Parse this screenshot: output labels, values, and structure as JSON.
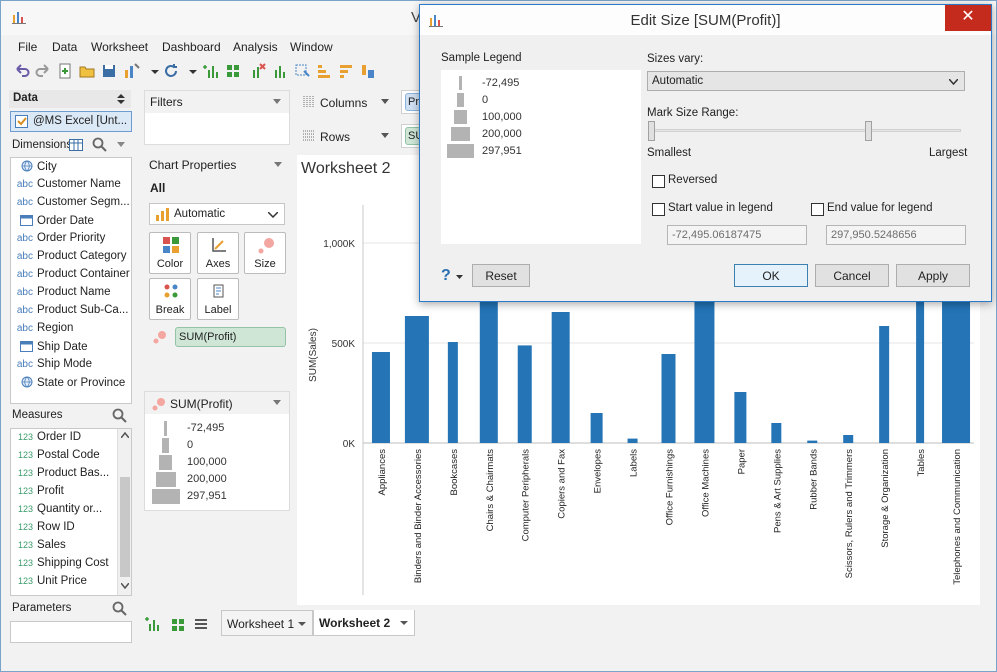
{
  "window": {
    "title": "V"
  },
  "menu": [
    "File",
    "Data",
    "Worksheet",
    "Dashboard",
    "Analysis",
    "Window"
  ],
  "data_panel": {
    "header": "Data",
    "source": "@MS Excel [Unt...",
    "dimensions_label": "Dimensions",
    "dimensions": [
      {
        "icon": "globe",
        "label": "City"
      },
      {
        "icon": "abc",
        "label": "Customer Name"
      },
      {
        "icon": "abc",
        "label": "Customer Segm..."
      },
      {
        "icon": "calendar",
        "label": "Order Date"
      },
      {
        "icon": "abc",
        "label": "Order Priority"
      },
      {
        "icon": "abc",
        "label": "Product Category"
      },
      {
        "icon": "abc",
        "label": "Product Container"
      },
      {
        "icon": "abc",
        "label": "Product Name"
      },
      {
        "icon": "abc",
        "label": "Product Sub-Ca..."
      },
      {
        "icon": "abc",
        "label": "Region"
      },
      {
        "icon": "calendar",
        "label": "Ship Date"
      },
      {
        "icon": "abc",
        "label": "Ship Mode"
      },
      {
        "icon": "globe",
        "label": "State or Province"
      }
    ],
    "measures_label": "Measures",
    "measures": [
      {
        "icon": "123",
        "label": "Order ID"
      },
      {
        "icon": "123",
        "label": "Postal Code"
      },
      {
        "icon": "123",
        "label": "Product Bas..."
      },
      {
        "icon": "123",
        "label": "Profit"
      },
      {
        "icon": "123",
        "label": "Quantity or..."
      },
      {
        "icon": "123",
        "label": "Row ID"
      },
      {
        "icon": "123",
        "label": "Sales"
      },
      {
        "icon": "123",
        "label": "Shipping Cost"
      },
      {
        "icon": "123",
        "label": "Unit Price"
      }
    ],
    "parameters_label": "Parameters",
    "abc": "abc",
    "num": "123"
  },
  "filters": {
    "label": "Filters"
  },
  "chart_properties": {
    "label": "Chart Properties",
    "all": "All",
    "mark_type": "Automatic",
    "buttons": {
      "color": "Color",
      "axes": "Axes",
      "size": "Size",
      "break": "Break",
      "label": "Label"
    },
    "size_pill": "SUM(Profit)"
  },
  "size_legend_card": {
    "title": "SUM(Profit)",
    "items": [
      "-72,495",
      "0",
      "100,000",
      "200,000",
      "297,951"
    ]
  },
  "shelves": {
    "columns": "Columns",
    "rows": "Rows",
    "columns_pill": "Pr",
    "rows_pill": "SU"
  },
  "worksheet": {
    "title": "Worksheet 2"
  },
  "chart_data": {
    "type": "bar",
    "ylabel": "SUM(Sales)",
    "y_ticks": [
      "1,000K",
      "500K",
      "0K"
    ],
    "ylim": [
      0,
      1200000
    ],
    "categories": [
      "Appliances",
      "Binders and Binder Accessories",
      "Bookcases",
      "Chairs & Chairmats",
      "Computer Peripherals",
      "Copiers and Fax",
      "Envelopes",
      "Labels",
      "Office Furnishings",
      "Office Machines",
      "Paper",
      "Pens & Art Supplies",
      "Rubber Bands",
      "Scissors, Rulers and Trimmers",
      "Storage & Organization",
      "Tables",
      "Telephones and Communication"
    ],
    "values": [
      455000,
      635000,
      505000,
      1130000,
      488000,
      655000,
      150000,
      22000,
      445000,
      1180000,
      255000,
      100000,
      12000,
      40000,
      585000,
      1100000,
      1200000
    ],
    "bar_color": "#2474b6"
  },
  "tabs": [
    "Worksheet 1",
    "Worksheet 2"
  ],
  "dialog": {
    "title": "Edit Size [SUM(Profit)]",
    "close_symbol": "✕",
    "sample_legend_label": "Sample Legend",
    "legend_items": [
      "-72,495",
      "0",
      "100,000",
      "200,000",
      "297,951"
    ],
    "sizes_vary_label": "Sizes vary:",
    "sizes_vary_value": "Automatic",
    "mark_size_range_label": "Mark Size Range:",
    "smallest_label": "Smallest",
    "largest_label": "Largest",
    "reversed_label": "Reversed",
    "start_value_label": "Start value in legend",
    "end_value_label": "End value for legend",
    "start_value": "-72,495.06187475",
    "end_value": "297,950.5248656",
    "reset_label": "Reset",
    "ok_label": "OK",
    "cancel_label": "Cancel",
    "apply_label": "Apply",
    "help_symbol": "?"
  }
}
